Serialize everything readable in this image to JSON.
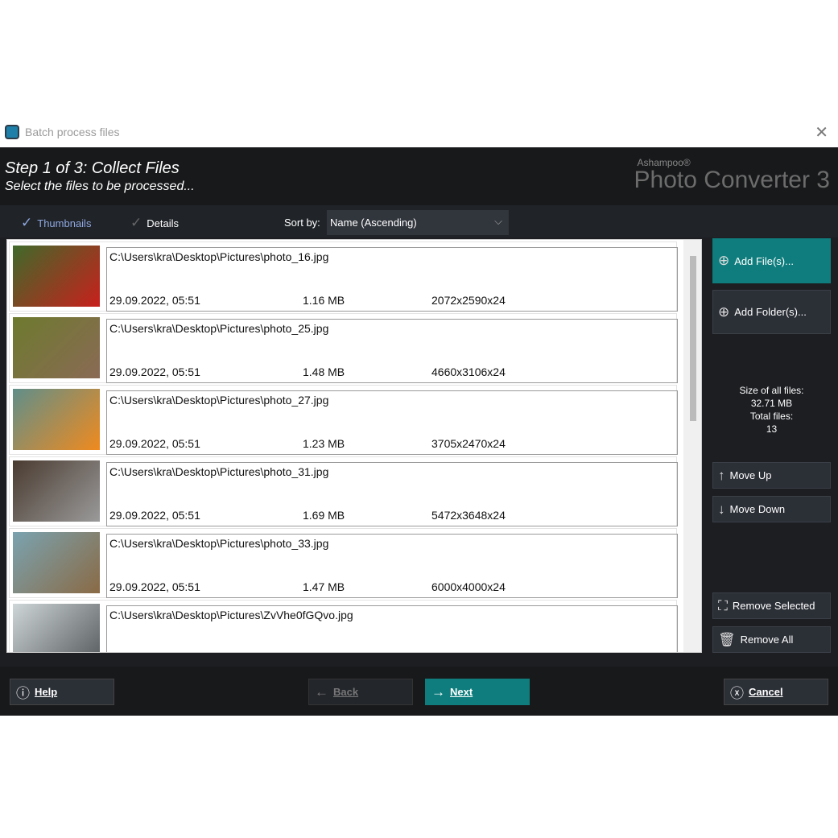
{
  "window": {
    "title": "Batch process files",
    "close": "✕"
  },
  "header": {
    "step": "Step 1 of 3: Collect Files",
    "subtitle": "Select the files to be processed...",
    "brand_small": "Ashampoo®",
    "brand": "Photo Converter 3"
  },
  "toolbar": {
    "tabs": [
      {
        "label": "Thumbnails",
        "active": true
      },
      {
        "label": "Details",
        "active": false
      }
    ],
    "sort_label": "Sort by:",
    "sort_value": "Name (Ascending)"
  },
  "files": [
    {
      "path": "C:\\Users\\kra\\Desktop\\Pictures\\photo_16.jpg",
      "date": "29.09.2022, 05:51",
      "size": "1.16 MB",
      "dims": "2072x2590x24",
      "thumb": [
        "#3f6a2a",
        "#c8201c"
      ]
    },
    {
      "path": "C:\\Users\\kra\\Desktop\\Pictures\\photo_25.jpg",
      "date": "29.09.2022, 05:51",
      "size": "1.48 MB",
      "dims": "4660x3106x24",
      "thumb": [
        "#6d7a2e",
        "#8a6a55"
      ]
    },
    {
      "path": "C:\\Users\\kra\\Desktop\\Pictures\\photo_27.jpg",
      "date": "29.09.2022, 05:51",
      "size": "1.23 MB",
      "dims": "3705x2470x24",
      "thumb": [
        "#5f8f8a",
        "#f08a1e"
      ]
    },
    {
      "path": "C:\\Users\\kra\\Desktop\\Pictures\\photo_31.jpg",
      "date": "29.09.2022, 05:51",
      "size": "1.69 MB",
      "dims": "5472x3648x24",
      "thumb": [
        "#4a3b30",
        "#9a9a9a"
      ]
    },
    {
      "path": "C:\\Users\\kra\\Desktop\\Pictures\\photo_33.jpg",
      "date": "29.09.2022, 05:51",
      "size": "1.47 MB",
      "dims": "6000x4000x24",
      "thumb": [
        "#7aa3b0",
        "#8a6a45"
      ]
    },
    {
      "path": "C:\\Users\\kra\\Desktop\\Pictures\\ZvVhe0fGQvo.jpg",
      "thumb": [
        "#cfd6d8",
        "#555a5c"
      ]
    }
  ],
  "sidebar": {
    "add_files": "Add File(s)...",
    "add_folders": "Add Folder(s)...",
    "size_label": "Size of all files:",
    "size_value": "32.71 MB",
    "total_label": "Total files:",
    "total_value": "13",
    "move_up": "Move Up",
    "move_down": "Move Down",
    "remove_selected": "Remove Selected",
    "remove_all": "Remove All"
  },
  "footer": {
    "help": "Help",
    "back": "Back",
    "next": "Next",
    "cancel": "Cancel"
  },
  "colors": {
    "accent": "#0f7d7d",
    "background": "#1c1e22"
  }
}
